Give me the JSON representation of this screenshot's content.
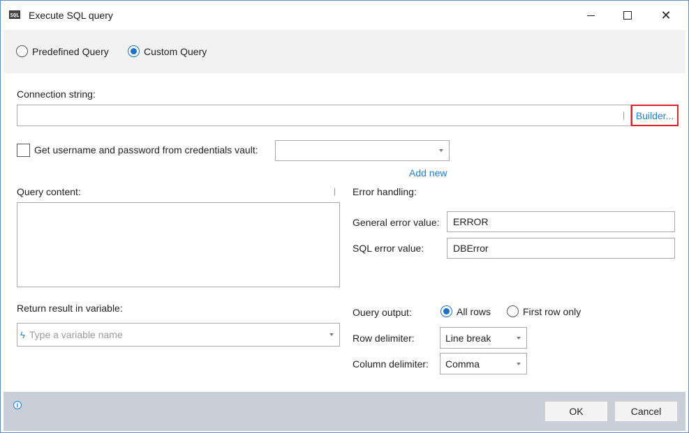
{
  "window": {
    "title": "Execute SQL query",
    "app_icon_text": "SQL",
    "minimize_icon": "minimize-icon",
    "maximize_icon": "maximize-icon",
    "close_glyph": "✕"
  },
  "query_type": {
    "options": [
      {
        "label": "Predefined Query",
        "selected": false
      },
      {
        "label": "Custom Query",
        "selected": true
      }
    ]
  },
  "connection": {
    "label": "Connection string:",
    "value": "",
    "builder_link": "Builder..."
  },
  "credentials": {
    "checkbox_label": "Get username and password from credentials vault:",
    "checked": false,
    "vault_value": "",
    "add_new_link": "Add new"
  },
  "query_content": {
    "label": "Query content:",
    "value": ""
  },
  "return_result": {
    "label": "Return result in variable:",
    "placeholder": "Type a variable name",
    "variable_icon": "variable-icon"
  },
  "error_handling": {
    "label": "Error handling:",
    "general_label": "General error value:",
    "general_value": "ERROR",
    "sql_label": "SQL error value:",
    "sql_value": "DBError"
  },
  "output": {
    "query_output_label": "Ouery output:",
    "options": [
      {
        "label": "All rows",
        "selected": true
      },
      {
        "label": "First row only",
        "selected": false
      }
    ],
    "row_delimiter_label": "Row delimiter:",
    "row_delimiter_value": "Line break",
    "column_delimiter_label": "Column delimiter:",
    "column_delimiter_value": "Comma"
  },
  "footer": {
    "info_icon": "info-icon",
    "info_glyph": "i",
    "ok_label": "OK",
    "cancel_label": "Cancel"
  },
  "colors": {
    "accent": "#1a73c8",
    "link": "#1e7fd6",
    "highlight_border": "#d9222a",
    "footer_bg": "#c8cfd9",
    "band_bg": "#f2f2f2"
  }
}
